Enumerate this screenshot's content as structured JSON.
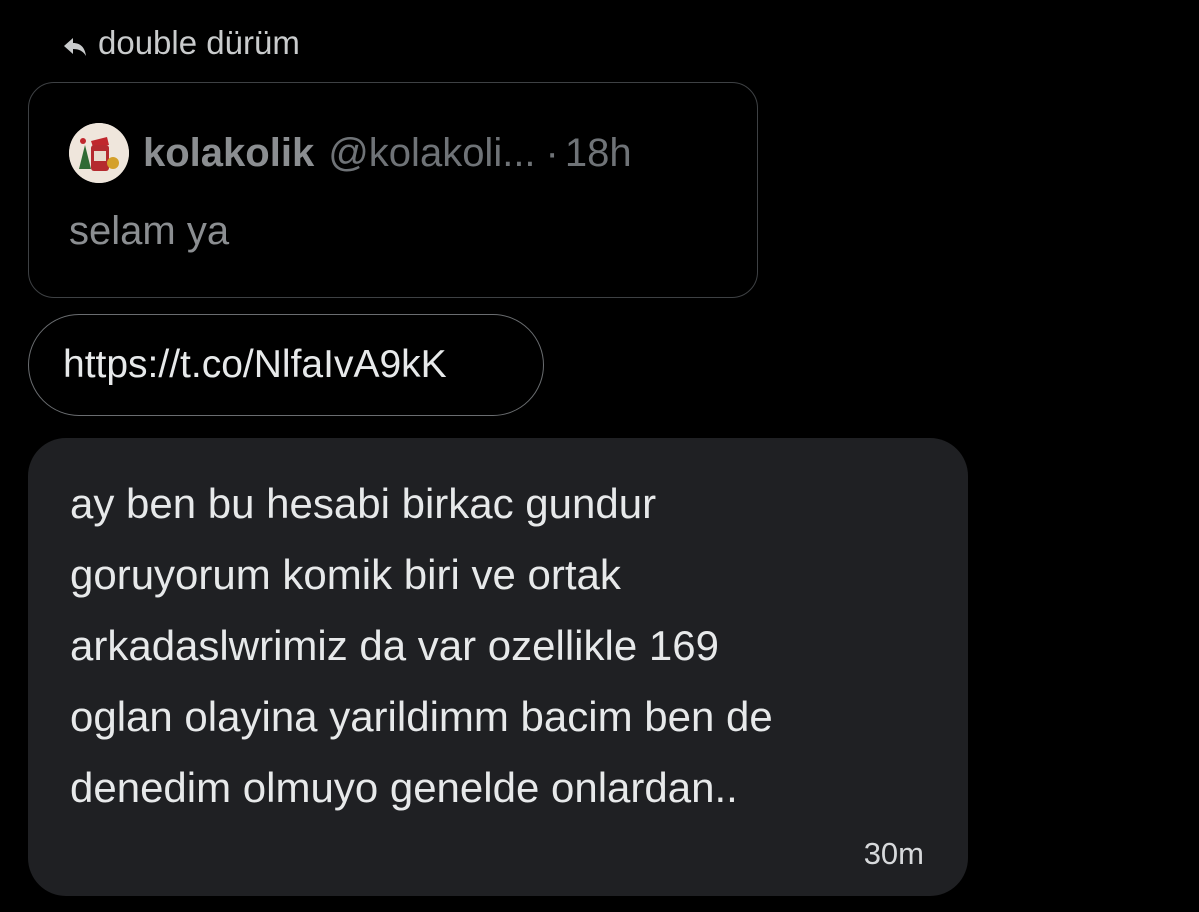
{
  "reply": {
    "icon": "reply-arrow-icon",
    "label": "double dürüm"
  },
  "quoted_tweet": {
    "avatar_icon": "avatar-icon",
    "display_name": "kolakolik",
    "handle": "@kolakoli...",
    "separator": "·",
    "time": "18h",
    "text": "selam ya"
  },
  "link_message": {
    "url": "https://t.co/NlfaIvA9kK"
  },
  "message": {
    "text": "ay ben bu hesabi birkac gundur\ngoruyorum komik biri ve ortak\narkadaslwrimiz da var ozellikle 169\noglan olayina yarildimm bacim ben de\ndenedim olmuyo genelde onlardan..",
    "time": "30m"
  },
  "colors": {
    "background": "#000000",
    "bubble": "#1f2023",
    "text_primary": "#e7e9ea",
    "text_muted": "#8b8e91"
  }
}
